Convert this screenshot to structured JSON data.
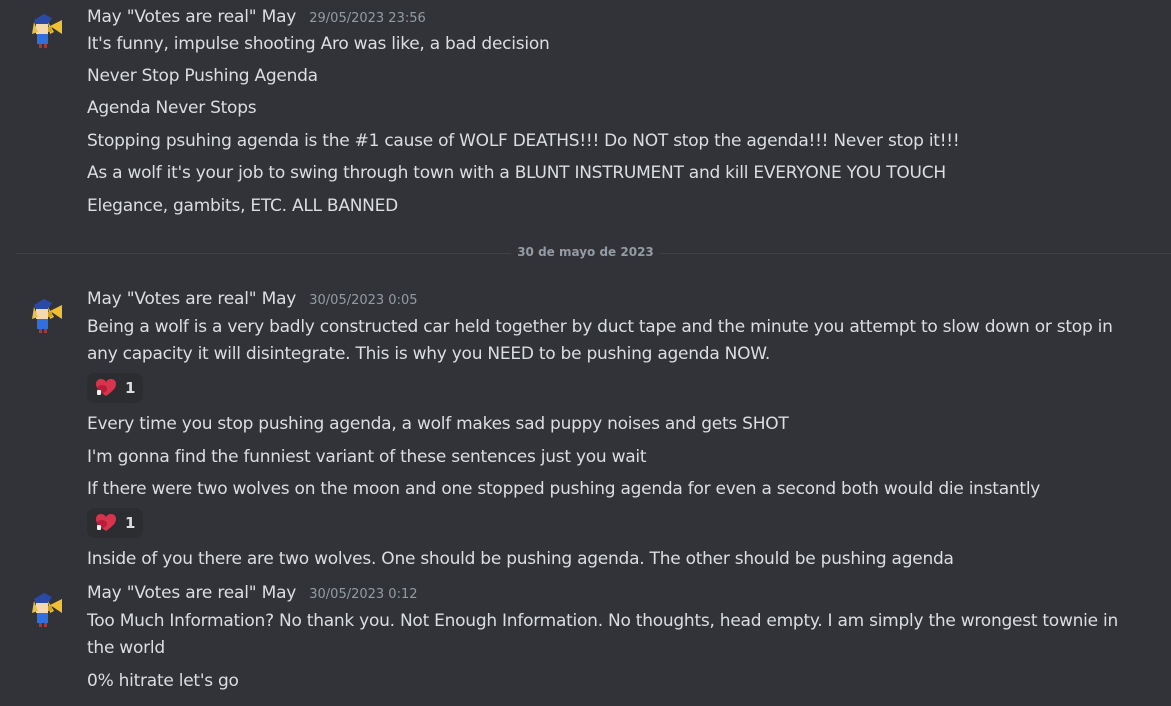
{
  "groups": [
    {
      "author": "May \"Votes are real\" May",
      "timestamp": "29/05/2023 23:56",
      "messages": [
        "It's funny, impulse shooting Aro was like, a bad decision",
        "Never Stop Pushing Agenda",
        "Agenda Never Stops",
        "Stopping psuhing agenda is the #1 cause of WOLF DEATHS!!! Do NOT stop the agenda!!! Never stop it!!!",
        "As a wolf it's your job to swing through town with a BLUNT INSTRUMENT and kill EVERYONE YOU TOUCH",
        "Elegance, gambits, ETC. ALL BANNED"
      ]
    },
    {
      "author": "May \"Votes are real\" May",
      "timestamp": "30/05/2023 0:05",
      "messages": [
        "Being a wolf is a very badly constructed car held together by duct tape and the minute you attempt to slow down or stop in any capacity it will disintegrate. This is why you NEED to be pushing agenda NOW.",
        "Every time you stop pushing agenda, a wolf makes sad puppy noises and gets SHOT",
        "I'm gonna find the funniest variant of these sentences just you wait",
        "If there were two wolves on the moon and one stopped pushing agenda for even a second both would die instantly",
        "Inside of you there are two wolves. One should be pushing agenda. The other should be pushing agenda"
      ],
      "reactions": [
        {
          "emoji": "boxing-glove-heart",
          "count": "1"
        },
        {
          "emoji": "boxing-glove-heart",
          "count": "1"
        }
      ]
    },
    {
      "author": "May \"Votes are real\" May",
      "timestamp": "30/05/2023 0:12",
      "messages": [
        "Too Much Information? No thank you. Not Enough Information. No thoughts, head empty. I am simply the wrongest townie in the world",
        "0% hitrate let's go"
      ]
    }
  ],
  "date_divider": "30 de mayo de 2023",
  "colors": {
    "background": "#313338",
    "text": "#dbdee1",
    "muted": "#949ba4",
    "reaction_bg": "#2b2d31"
  }
}
